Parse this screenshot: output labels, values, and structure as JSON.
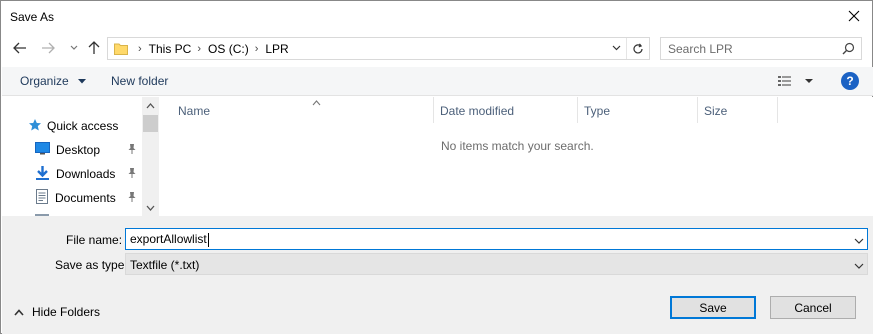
{
  "window": {
    "title": "Save As"
  },
  "address": {
    "crumbs": [
      "This PC",
      "OS (C:)",
      "LPR"
    ]
  },
  "search": {
    "placeholder": "Search LPR"
  },
  "toolbar": {
    "organize_label": "Organize",
    "new_folder_label": "New folder",
    "help_label": "?"
  },
  "navpane": {
    "items": [
      {
        "label": "Quick access",
        "icon": "star-icon",
        "pinned": false
      },
      {
        "label": "Desktop",
        "icon": "desktop-icon",
        "pinned": true
      },
      {
        "label": "Downloads",
        "icon": "download-arrow-icon",
        "pinned": true
      },
      {
        "label": "Documents",
        "icon": "document-icon",
        "pinned": true
      }
    ]
  },
  "filelist": {
    "columns": [
      "Name",
      "Date modified",
      "Type",
      "Size"
    ],
    "empty_message": "No items match your search."
  },
  "bottom": {
    "file_name_label": "File name:",
    "file_name_value": "exportAllowlist",
    "save_as_type_label": "Save as type:",
    "save_as_type_value": "Textfile (*.txt)",
    "hide_folders_label": "Hide Folders",
    "save_label": "Save",
    "cancel_label": "Cancel"
  },
  "colors": {
    "accent": "#0078d7",
    "help": "#1b62c4",
    "toolbar_bg": "#f5f6f7",
    "panel_bg": "#f0f0f0"
  }
}
